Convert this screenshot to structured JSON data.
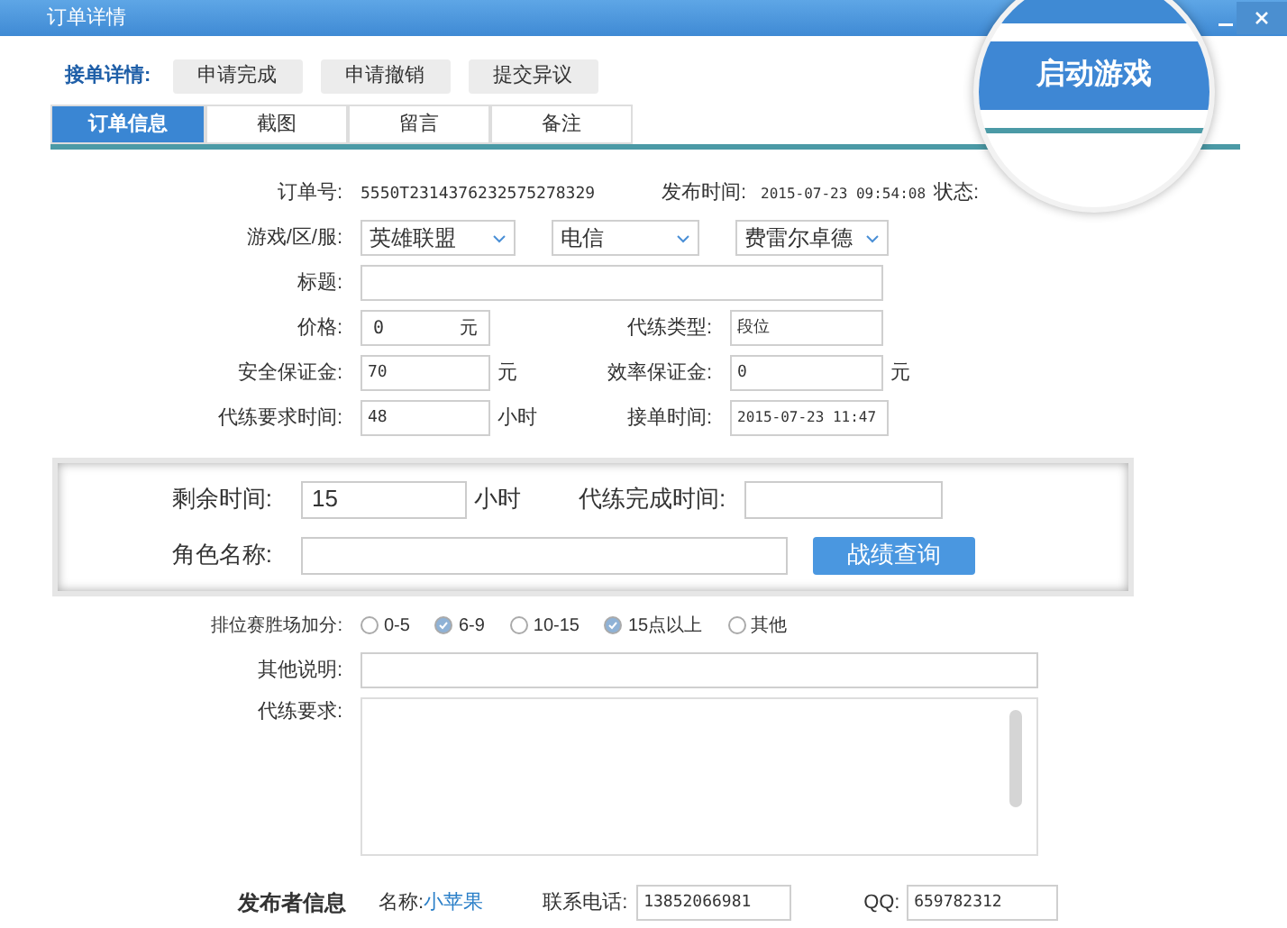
{
  "window": {
    "title": "订单详情"
  },
  "actions": {
    "label": "接单详情:",
    "buttons": [
      "申请完成",
      "申请撤销",
      "提交异议"
    ]
  },
  "tabs": [
    {
      "label": "订单信息",
      "selected": true
    },
    {
      "label": "截图",
      "selected": false
    },
    {
      "label": "留言",
      "selected": false
    },
    {
      "label": "备注",
      "selected": false
    }
  ],
  "launch_button": "启动游戏",
  "order": {
    "order_no_label": "订单号:",
    "order_no": "5550T2314376232575278329",
    "publish_time_label": "发布时间:",
    "publish_time": "2015-07-23 09:54:08",
    "status_label": "状态:",
    "server_label": "游戏/区/服:",
    "selects": [
      "英雄联盟",
      "电信",
      "费雷尔卓德"
    ],
    "title_label": "标题:",
    "price_label": "价格:",
    "price": "0",
    "price_unit": "元",
    "type_label": "代练类型:",
    "type": "段位",
    "deposit_label": "安全保证金:",
    "deposit": "70",
    "deposit_unit": "元",
    "eff_label": "效率保证金:",
    "eff": "0",
    "eff_unit": "元",
    "hours_label": "代练要求时间:",
    "hours": "48",
    "hours_unit": "小时",
    "accept_label": "接单时间:",
    "accept_time": "2015-07-23 11:47"
  },
  "highlight": {
    "remain_label": "剩余时间:",
    "remain": "15",
    "remain_unit": "小时",
    "finish_label": "代练完成时间:",
    "role_label": "角色名称:",
    "query_button": "战绩查询"
  },
  "bonus": {
    "label": "排位赛胜场加分:",
    "options": [
      {
        "label": "0-5",
        "checked": false
      },
      {
        "label": "6-9",
        "checked": true
      },
      {
        "label": "10-15",
        "checked": false
      },
      {
        "label": "15点以上",
        "checked": true
      },
      {
        "label": "其他",
        "checked": false
      }
    ]
  },
  "other_label": "其他说明:",
  "requirements_label": "代练要求:",
  "publisher": {
    "heading": "发布者信息",
    "name_label": "名称:",
    "name": "小苹果",
    "phone_label": "联系电话:",
    "phone": "13852066981",
    "qq_label": "QQ:",
    "qq": "659782312"
  }
}
